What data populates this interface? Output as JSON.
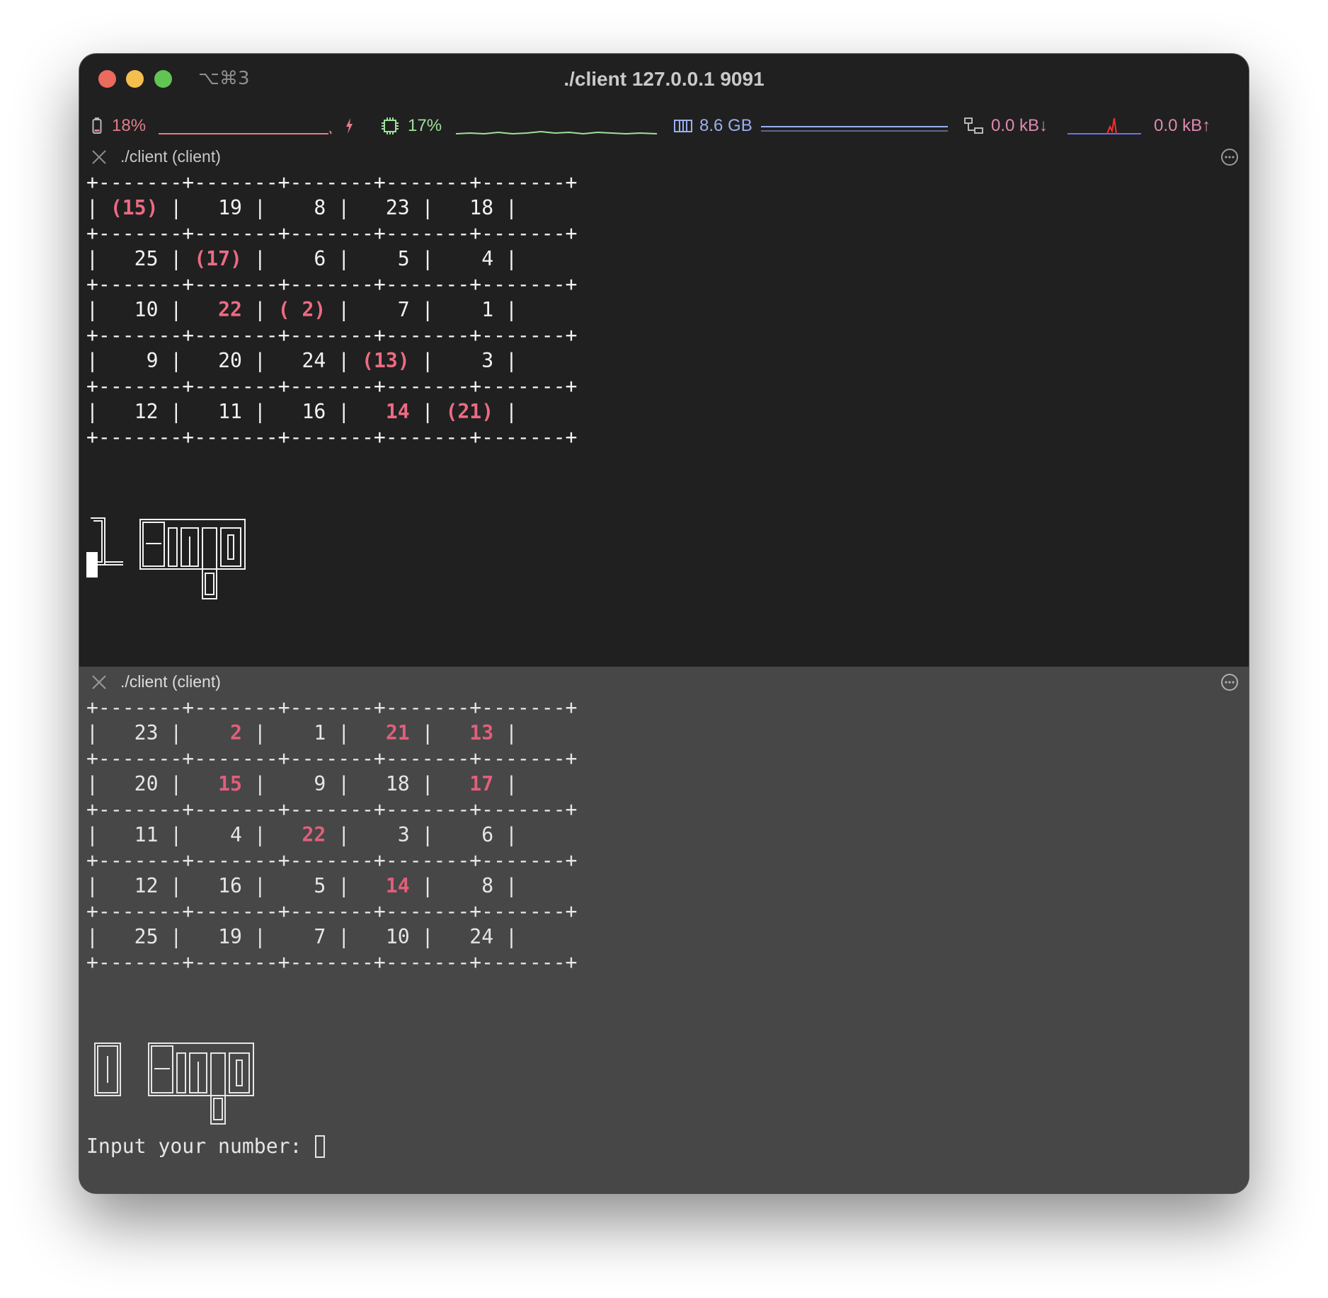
{
  "window": {
    "title": "./client 127.0.0.1 9091",
    "shortcut": "⌥⌘3"
  },
  "status": {
    "battery": "18%",
    "cpu": "17%",
    "memory": "8.6 GB",
    "net_down": "0.0 kB↓",
    "net_up": "0.0 kB↑",
    "colors": {
      "battery": "#e07e8a",
      "cpu": "#9ee09a",
      "memory": "#9ab0f0",
      "network": "#e08ab0"
    }
  },
  "panes": [
    {
      "title": "./client (client)",
      "border": "+-------+-------+-------+-------+-------+",
      "rows": [
        [
          {
            "t": "(15)",
            "hl": true
          },
          {
            "t": "19",
            "hl": false
          },
          {
            "t": "8",
            "hl": false
          },
          {
            "t": "23",
            "hl": false
          },
          {
            "t": "18",
            "hl": false
          }
        ],
        [
          {
            "t": "25",
            "hl": false
          },
          {
            "t": "(17)",
            "hl": true
          },
          {
            "t": "6",
            "hl": false
          },
          {
            "t": "5",
            "hl": false
          },
          {
            "t": "4",
            "hl": false
          }
        ],
        [
          {
            "t": "10",
            "hl": false
          },
          {
            "t": "22",
            "hl": true
          },
          {
            "t": "( 2)",
            "hl": true
          },
          {
            "t": "7",
            "hl": false
          },
          {
            "t": "1",
            "hl": false
          }
        ],
        [
          {
            "t": "9",
            "hl": false
          },
          {
            "t": "20",
            "hl": false
          },
          {
            "t": "24",
            "hl": false
          },
          {
            "t": "(13)",
            "hl": true
          },
          {
            "t": "3",
            "hl": false
          }
        ],
        [
          {
            "t": "12",
            "hl": false
          },
          {
            "t": "11",
            "hl": false
          },
          {
            "t": "16",
            "hl": false
          },
          {
            "t": "14",
            "hl": true
          },
          {
            "t": "(21)",
            "hl": true
          }
        ]
      ],
      "bingo_count": "1",
      "bingo_word": "Bingo"
    },
    {
      "title": "./client (client)",
      "border": "+-------+-------+-------+-------+-------+",
      "rows": [
        [
          {
            "t": "23",
            "hl": false
          },
          {
            "t": "2",
            "hl": true
          },
          {
            "t": "1",
            "hl": false
          },
          {
            "t": "21",
            "hl": true
          },
          {
            "t": "13",
            "hl": true
          }
        ],
        [
          {
            "t": "20",
            "hl": false
          },
          {
            "t": "15",
            "hl": true
          },
          {
            "t": "9",
            "hl": false
          },
          {
            "t": "18",
            "hl": false
          },
          {
            "t": "17",
            "hl": true
          }
        ],
        [
          {
            "t": "11",
            "hl": false
          },
          {
            "t": "4",
            "hl": false
          },
          {
            "t": "22",
            "hl": true
          },
          {
            "t": "3",
            "hl": false
          },
          {
            "t": "6",
            "hl": false
          }
        ],
        [
          {
            "t": "12",
            "hl": false
          },
          {
            "t": "16",
            "hl": false
          },
          {
            "t": "5",
            "hl": false
          },
          {
            "t": "14",
            "hl": true
          },
          {
            "t": "8",
            "hl": false
          }
        ],
        [
          {
            "t": "25",
            "hl": false
          },
          {
            "t": "19",
            "hl": false
          },
          {
            "t": "7",
            "hl": false
          },
          {
            "t": "10",
            "hl": false
          },
          {
            "t": "24",
            "hl": false
          }
        ]
      ],
      "bingo_count": "0",
      "bingo_word": "Bingo",
      "prompt": "Input your number: "
    }
  ]
}
